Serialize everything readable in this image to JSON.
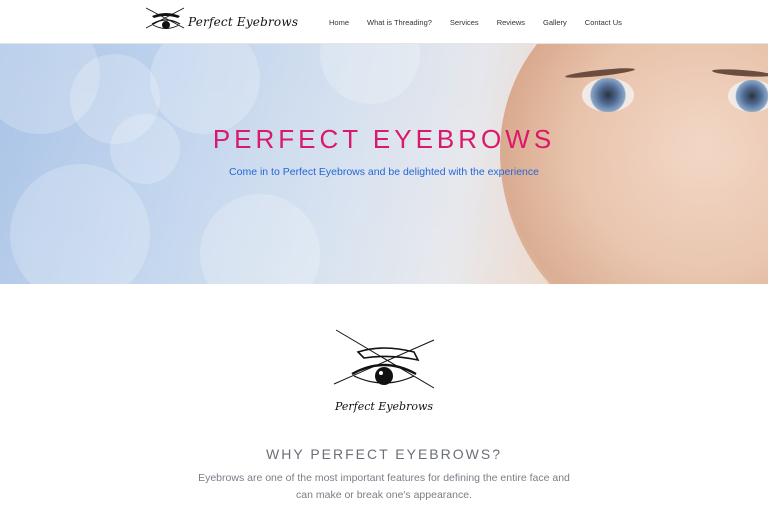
{
  "brand": {
    "logo_text": "Perfect Eyebrows"
  },
  "nav": {
    "items": [
      "Home",
      "What is Threading?",
      "Services",
      "Reviews",
      "Gallery",
      "Contact Us"
    ]
  },
  "hero": {
    "title": "PERFECT EYEBROWS",
    "subtitle": "Come in to Perfect Eyebrows and be delighted with the experience"
  },
  "intro": {
    "logo_text": "Perfect Eyebrows",
    "heading": "WHY PERFECT EYEBROWS?",
    "text": "Eyebrows are one of the most important features for defining the entire face and can make or break one's appearance."
  },
  "colors": {
    "title_pink": "#d9196a",
    "subtitle_blue": "#2766d6",
    "heading_gray": "#6a6f78"
  }
}
